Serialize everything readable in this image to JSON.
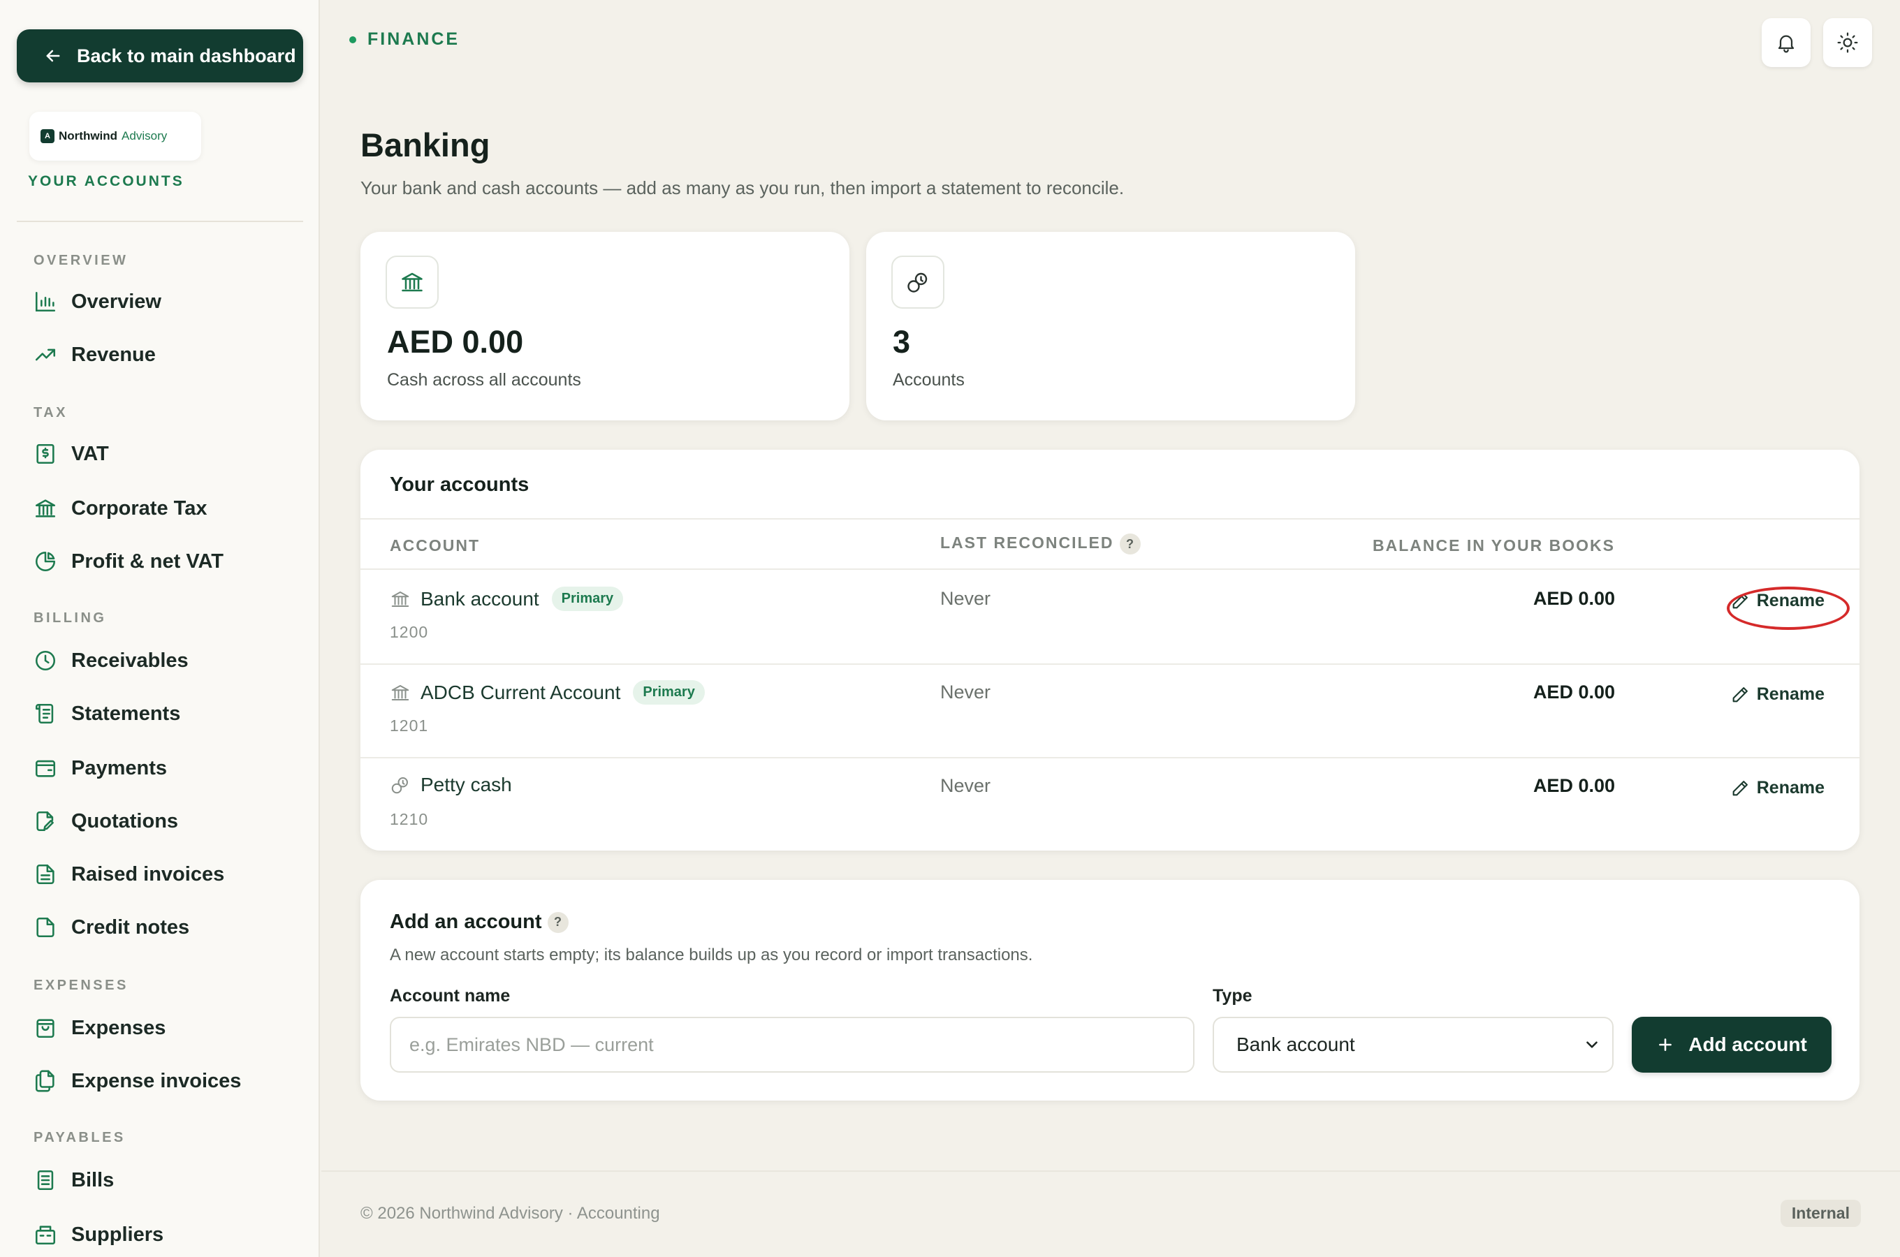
{
  "sidebar": {
    "back_label": "Back to main dashboard",
    "brand_name": "Northwind",
    "brand_suffix": "Advisory",
    "brand_mark": "A",
    "your_accounts": "YOUR ACCOUNTS",
    "sections": {
      "overview": "OVERVIEW",
      "tax": "TAX",
      "billing": "BILLING",
      "expenses": "EXPENSES",
      "payables": "PAYABLES"
    },
    "items": {
      "overview": "Overview",
      "revenue": "Revenue",
      "vat": "VAT",
      "corporate_tax": "Corporate Tax",
      "profit_vat": "Profit & net VAT",
      "receivables": "Receivables",
      "statements": "Statements",
      "payments": "Payments",
      "quotations": "Quotations",
      "raised_invoices": "Raised invoices",
      "credit_notes": "Credit notes",
      "expenses": "Expenses",
      "expense_invoices": "Expense invoices",
      "bills": "Bills",
      "suppliers": "Suppliers"
    }
  },
  "header": {
    "breadcrumb": "FINANCE",
    "icons": [
      "bell-icon",
      "sun-icon"
    ]
  },
  "page": {
    "title": "Banking",
    "subtitle": "Your bank and cash accounts — add as many as you run, then import a statement to reconcile."
  },
  "stats": {
    "cash_value": "AED 0.00",
    "cash_label": "Cash across all accounts",
    "accounts_value": "3",
    "accounts_label": "Accounts"
  },
  "accounts_table": {
    "title": "Your accounts",
    "headers": {
      "account": "ACCOUNT",
      "last_reconciled": "LAST RECONCILED",
      "balance": "BALANCE IN YOUR BOOKS"
    },
    "help_glyph": "?",
    "rename_label": "Rename",
    "rows": [
      {
        "name": "Bank account",
        "badge": "Primary",
        "code": "1200",
        "reconciled": "Never",
        "balance": "AED 0.00",
        "icon": "bank-icon"
      },
      {
        "name": "ADCB Current Account",
        "badge": "Primary",
        "code": "1201",
        "reconciled": "Never",
        "balance": "AED 0.00",
        "icon": "bank-icon"
      },
      {
        "name": "Petty cash",
        "badge": "",
        "code": "1210",
        "reconciled": "Never",
        "balance": "AED 0.00",
        "icon": "coins-icon"
      }
    ]
  },
  "add_account": {
    "title": "Add an account",
    "description": "A new account starts empty; its balance builds up as you record or import transactions.",
    "name_label": "Account name",
    "name_placeholder": "e.g. Emirates NBD — current",
    "name_value": "",
    "type_label": "Type",
    "type_value": "Bank account",
    "button_label": "Add account"
  },
  "footer": {
    "copyright": "© 2026 Northwind Advisory · Accounting",
    "badge": "Internal"
  },
  "colors": {
    "primary": "#123c30",
    "accent": "#1d7a4f",
    "highlight_ring": "#d52a2a"
  }
}
